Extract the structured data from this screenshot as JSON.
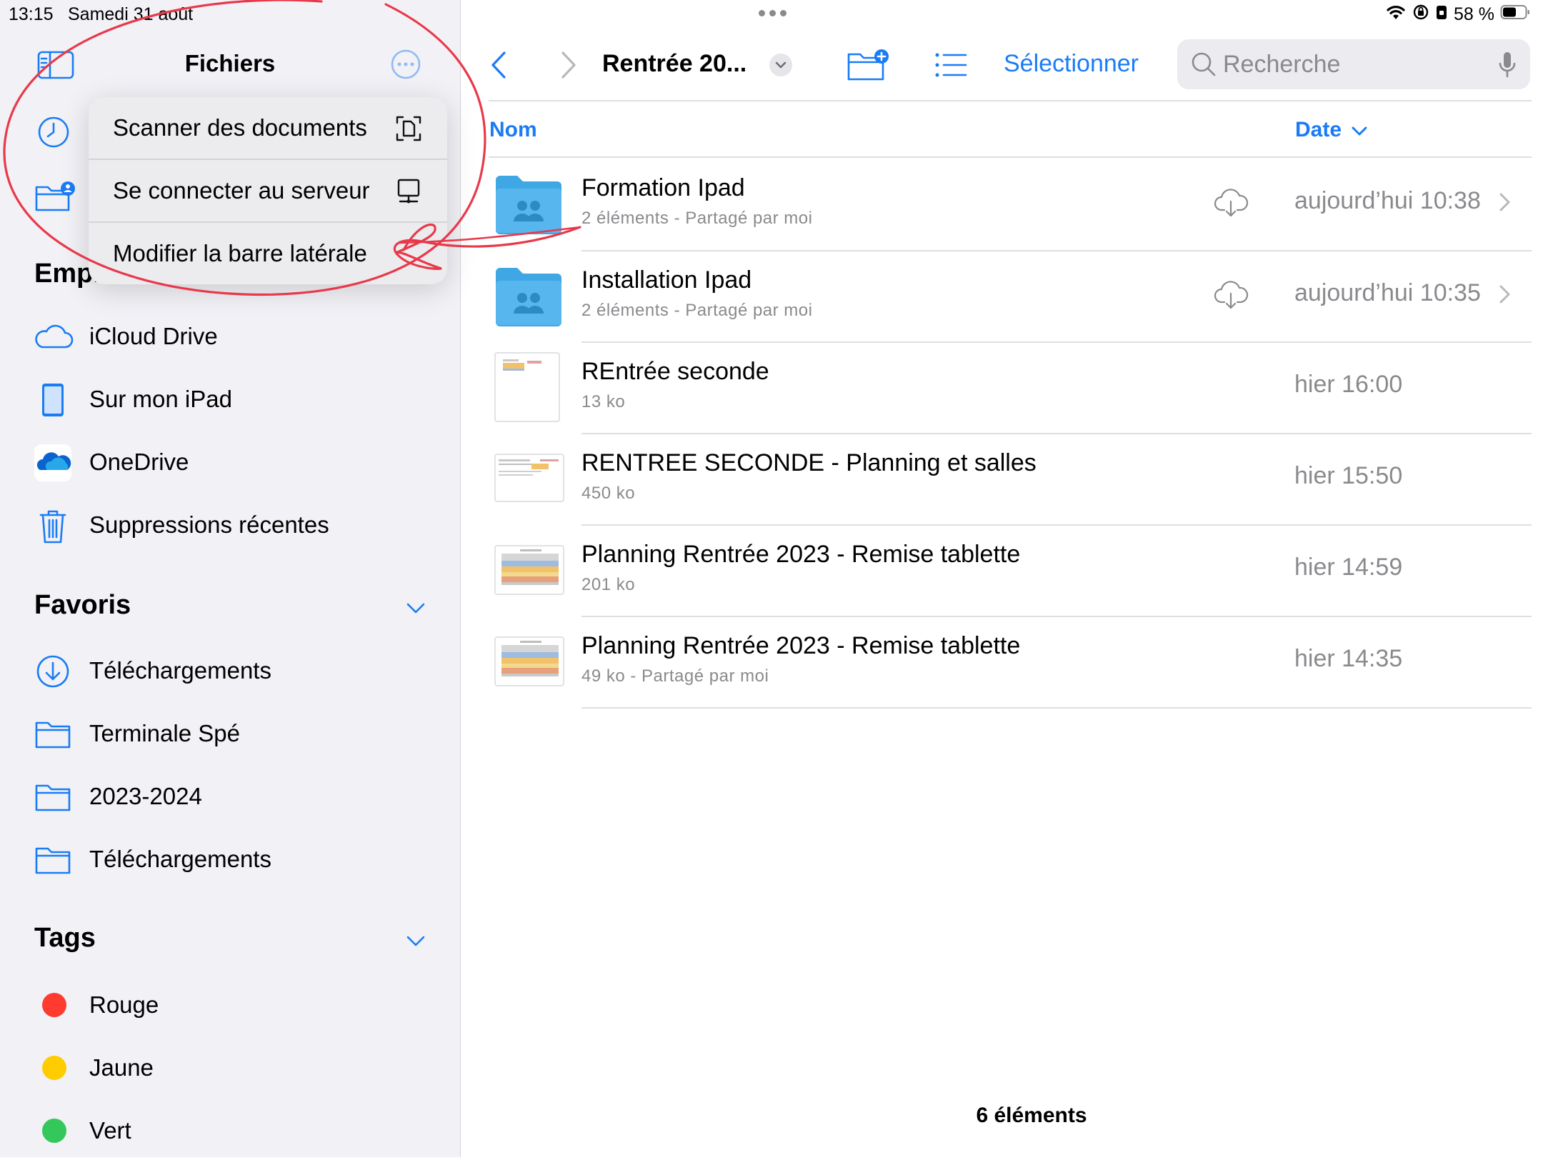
{
  "status_bar": {
    "time": "13:15",
    "date": "Samedi 31 août",
    "battery": "58 %"
  },
  "sidebar": {
    "title": "Fichiers",
    "locations_header": "Emp.",
    "locations": [
      {
        "label": "iCloud Drive",
        "icon": "icloud-icon"
      },
      {
        "label": "Sur mon iPad",
        "icon": "ipad-icon"
      },
      {
        "label": "OneDrive",
        "icon": "onedrive-icon"
      },
      {
        "label": "Suppressions récentes",
        "icon": "trash-icon"
      }
    ],
    "favorites_header": "Favoris",
    "favorites": [
      {
        "label": "Téléchargements",
        "icon": "download-icon"
      },
      {
        "label": "Terminale Spé",
        "icon": "folder-icon"
      },
      {
        "label": "2023-2024",
        "icon": "folder-icon"
      },
      {
        "label": "Téléchargements",
        "icon": "folder-icon"
      }
    ],
    "tags_header": "Tags",
    "tags": [
      {
        "label": "Rouge",
        "color": "#ff3b30"
      },
      {
        "label": "Jaune",
        "color": "#ffcc00"
      },
      {
        "label": "Vert",
        "color": "#34c759"
      }
    ]
  },
  "menu": {
    "items": [
      {
        "label": "Scanner des documents",
        "icon": "scan-document-icon"
      },
      {
        "label": "Se connecter au serveur",
        "icon": "server-icon"
      },
      {
        "label": "Modifier la barre latérale",
        "icon": ""
      }
    ]
  },
  "toolbar": {
    "folder_title": "Rentrée 20...",
    "select_label": "Sélectionner",
    "search_placeholder": "Recherche"
  },
  "columns": {
    "name": "Nom",
    "date": "Date"
  },
  "files": [
    {
      "name": "Formation Ipad",
      "sub": "2 éléments - Partagé par moi",
      "date": "aujourd’hui 10:38",
      "type": "shared-folder"
    },
    {
      "name": "Installation Ipad",
      "sub": "2 éléments - Partagé par moi",
      "date": "aujourd’hui 10:35",
      "type": "shared-folder"
    },
    {
      "name": "REntrée seconde",
      "sub": "13 ko",
      "date": "hier 16:00",
      "type": "spreadsheet"
    },
    {
      "name": "RENTREE SECONDE - Planning et salles",
      "sub": "450 ko",
      "date": "hier 15:50",
      "type": "spreadsheet"
    },
    {
      "name": "Planning Rentrée 2023 - Remise tablette",
      "sub": "201 ko",
      "date": "hier 14:59",
      "type": "spreadsheet"
    },
    {
      "name": "Planning Rentrée 2023 - Remise tablette",
      "sub": "49 ko - Partagé par moi",
      "date": "hier 14:35",
      "type": "spreadsheet"
    }
  ],
  "footer": {
    "count": "6 éléments"
  },
  "colors": {
    "accent": "#1a7cf5",
    "annotation": "#e8394a"
  }
}
